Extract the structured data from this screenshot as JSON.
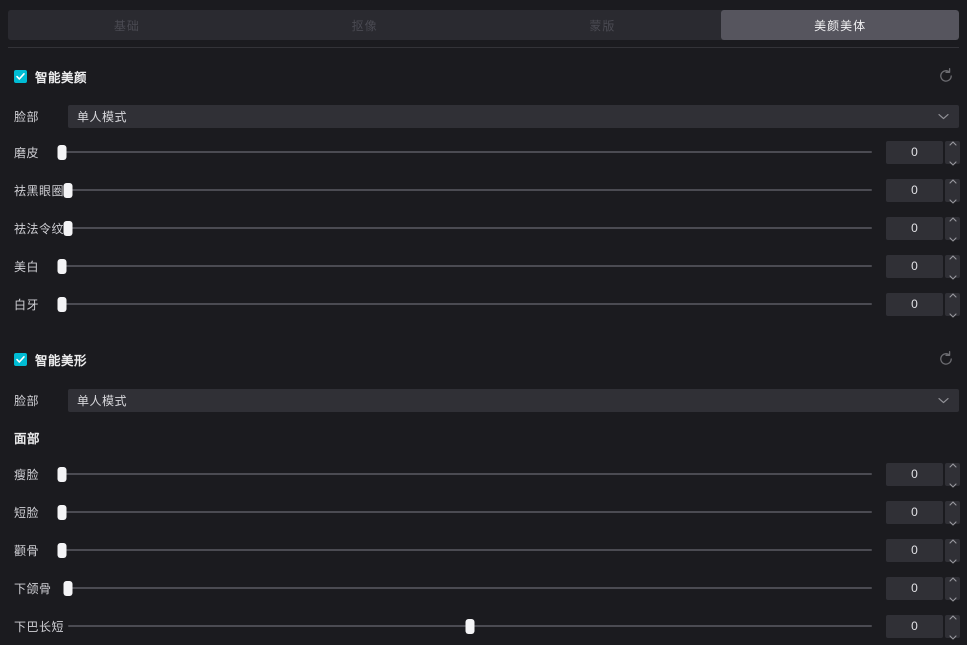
{
  "tabs": [
    {
      "label": "基础",
      "active": false
    },
    {
      "label": "抠像",
      "active": false
    },
    {
      "label": "蒙版",
      "active": false
    },
    {
      "label": "美颜美体",
      "active": true
    }
  ],
  "sections": [
    {
      "title": "智能美颜",
      "checked": true,
      "reset_icon": "reset-circular-arrow-icon",
      "select": {
        "label": "脸部",
        "value": "单人模式",
        "chevron_icon": "chevron-down-icon"
      },
      "sliders": [
        {
          "label": "磨皮",
          "value": "0",
          "pct": 0
        },
        {
          "label": "祛黑眼圈",
          "value": "0",
          "pct": 0
        },
        {
          "label": "祛法令纹",
          "value": "0",
          "pct": 0
        },
        {
          "label": "美白",
          "value": "0",
          "pct": 0
        },
        {
          "label": "白牙",
          "value": "0",
          "pct": 0
        }
      ]
    },
    {
      "title": "智能美形",
      "checked": true,
      "reset_icon": "reset-circular-arrow-icon",
      "select": {
        "label": "脸部",
        "value": "单人模式",
        "chevron_icon": "chevron-down-icon"
      },
      "subheading": "面部",
      "sliders": [
        {
          "label": "瘦脸",
          "value": "0",
          "pct": 0
        },
        {
          "label": "短脸",
          "value": "0",
          "pct": 0
        },
        {
          "label": "颧骨",
          "value": "0",
          "pct": 0
        },
        {
          "label": "下颌骨",
          "value": "0",
          "pct": 0
        },
        {
          "label": "下巴长短",
          "value": "0",
          "pct": 50
        }
      ]
    }
  ],
  "colors": {
    "background": "#1b1b1f",
    "tab_inactive_bg": "#2a2a30",
    "tab_active_bg": "#56555e",
    "accent_checkbox": "#00bcd4",
    "field_bg": "#303036",
    "slider_track": "#4b4b52",
    "slider_handle": "#f4f4f6"
  }
}
